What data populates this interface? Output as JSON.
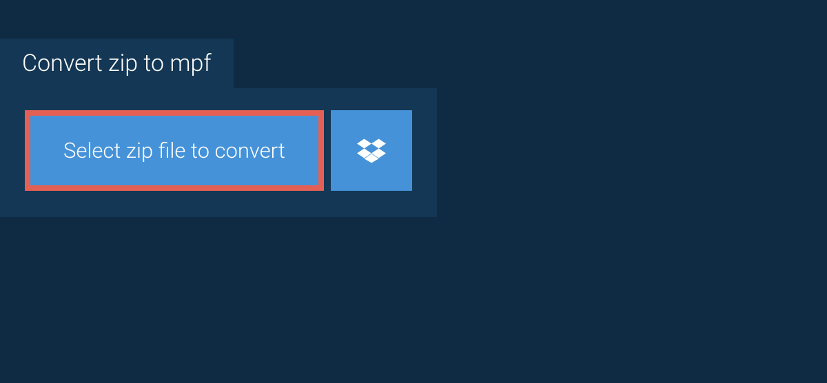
{
  "tab": {
    "title": "Convert zip to mpf"
  },
  "actions": {
    "select_file_label": "Select zip file to convert"
  }
}
